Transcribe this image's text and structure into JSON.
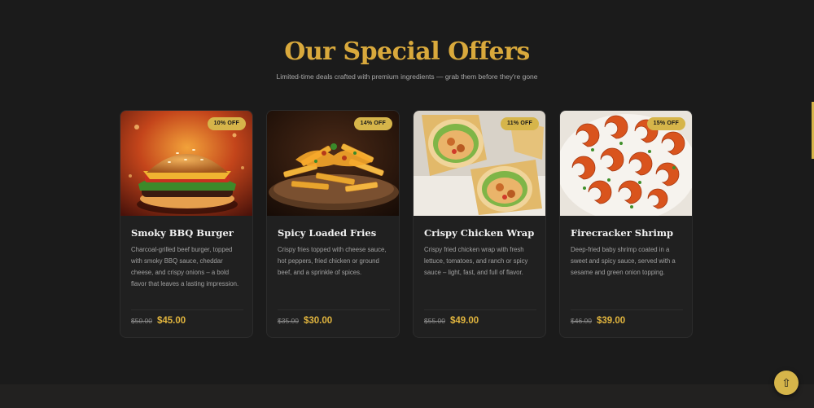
{
  "section": {
    "title": "Our Special Offers",
    "subtitle": "Limited-time deals crafted with premium ingredients — grab them before they're gone"
  },
  "offers": [
    {
      "name": "Smoky BBQ Burger",
      "discount": "10% OFF",
      "description": "Charcoal-grilled beef burger, topped with smoky BBQ sauce, cheddar cheese, and crispy onions – a bold flavor that leaves a lasting impression.",
      "old_price": "$50.00",
      "new_price": "$45.00",
      "image": "burger-photo"
    },
    {
      "name": "Spicy Loaded Fries",
      "discount": "14% OFF",
      "description": "Crispy fries topped with cheese sauce, hot peppers, fried chicken or ground beef, and a sprinkle of spices.",
      "old_price": "$35.00",
      "new_price": "$30.00",
      "image": "loaded-fries-photo"
    },
    {
      "name": "Crispy Chicken Wrap",
      "discount": "11% OFF",
      "description": "Crispy fried chicken wrap with fresh lettuce, tomatoes, and ranch or spicy sauce – light, fast, and full of flavor.",
      "old_price": "$55.00",
      "new_price": "$49.00",
      "image": "chicken-wrap-photo"
    },
    {
      "name": "Firecracker Shrimp",
      "discount": "15% OFF",
      "description": "Deep-fried baby shrimp coated in a sweet and spicy sauce, served with a sesame and green onion topping.",
      "old_price": "$46.00",
      "new_price": "$39.00",
      "image": "shrimp-photo"
    }
  ],
  "scroll_top": {
    "icon": "arrow-up-icon",
    "glyph": "⇧"
  },
  "colors": {
    "accent": "#d6b54a",
    "title": "#d9a93c",
    "background": "#1b1b1b",
    "card": "#202020"
  }
}
